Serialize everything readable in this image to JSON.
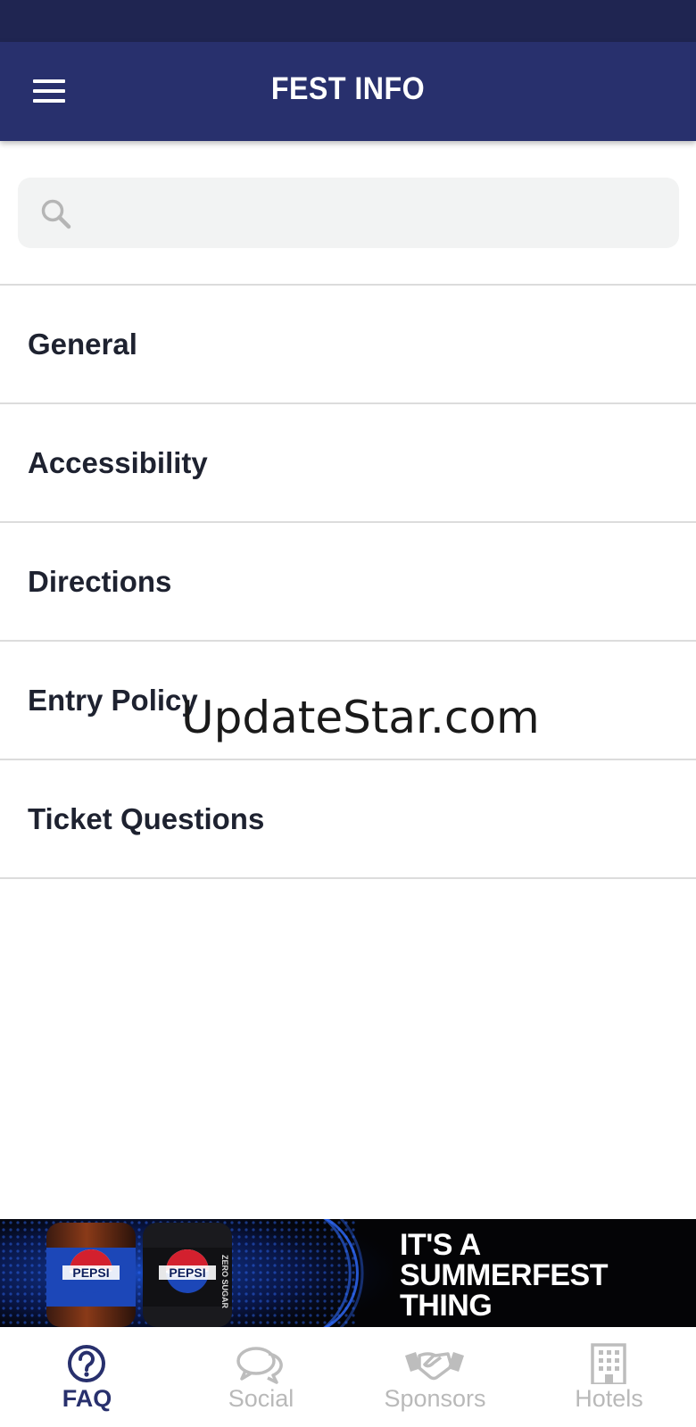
{
  "header": {
    "title": "FEST INFO"
  },
  "search": {
    "placeholder": "",
    "value": ""
  },
  "faq_categories": [
    {
      "label": "General"
    },
    {
      "label": "Accessibility"
    },
    {
      "label": "Directions"
    },
    {
      "label": "Entry Policy"
    },
    {
      "label": "Ticket Questions"
    }
  ],
  "watermark": "UpdateStar.com",
  "ad": {
    "brand_bottle_1": "PEPSI",
    "brand_bottle_2": "PEPSI",
    "bottle_2_variant": "ZERO SUGAR",
    "headline_lines": [
      "IT'S A",
      "SUMMERFEST",
      "THING"
    ]
  },
  "bottom_nav": [
    {
      "label": "FAQ",
      "icon": "question-circle-icon",
      "active": true
    },
    {
      "label": "Social",
      "icon": "chat-bubbles-icon",
      "active": false
    },
    {
      "label": "Sponsors",
      "icon": "handshake-icon",
      "active": false
    },
    {
      "label": "Hotels",
      "icon": "building-icon",
      "active": false
    }
  ],
  "colors": {
    "header_bg": "#28306d",
    "status_bar_bg": "#1f2551",
    "active_nav": "#28306d",
    "inactive_nav": "#b9b9b9",
    "divider": "#dcdcdc"
  }
}
